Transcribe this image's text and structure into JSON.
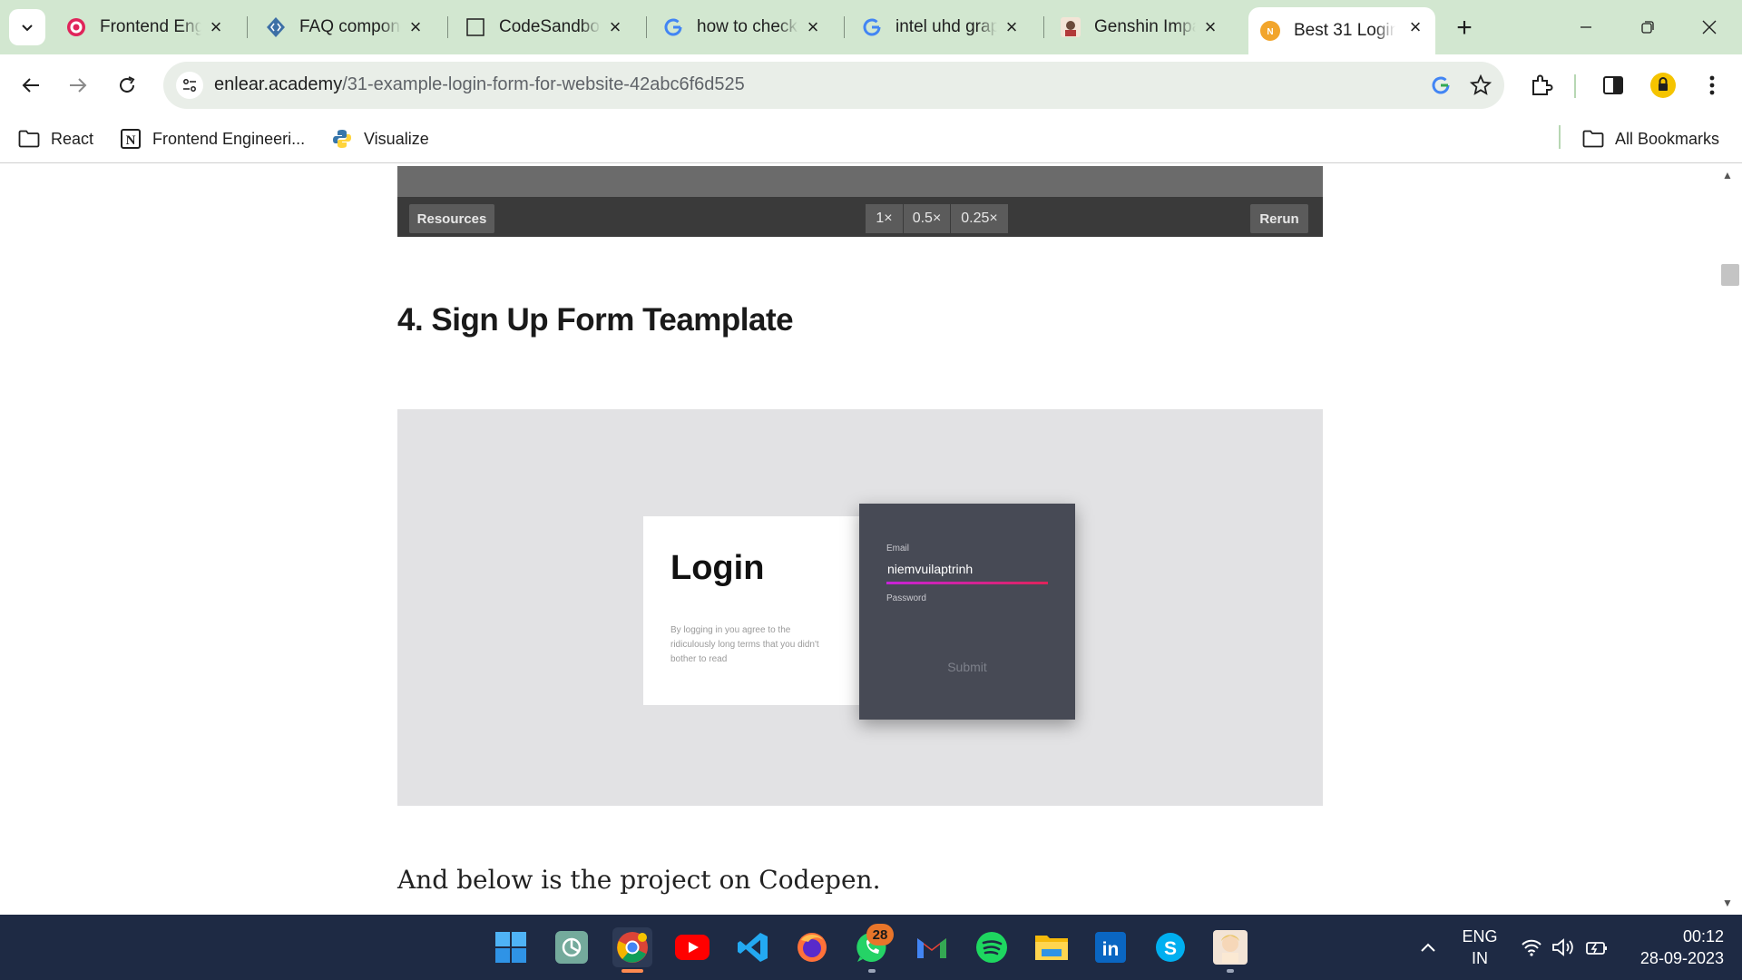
{
  "browser": {
    "tabs": [
      {
        "title": "Frontend Eng",
        "favicon": "target-icon"
      },
      {
        "title": "FAQ compone",
        "favicon": "code-icon"
      },
      {
        "title": "CodeSandbox",
        "favicon": "box-icon"
      },
      {
        "title": "how to check",
        "favicon": "google-icon"
      },
      {
        "title": "intel uhd grap",
        "favicon": "google-icon"
      },
      {
        "title": "Genshin Impa",
        "favicon": "anime-icon"
      },
      {
        "title": "Best 31 Login",
        "favicon": "enlear-icon",
        "active": true
      }
    ],
    "url_host": "enlear.academy",
    "url_path": "/31-example-login-form-for-website-42abc6f6d525"
  },
  "bookmarks": [
    {
      "label": "React",
      "icon": "folder-icon"
    },
    {
      "label": "Frontend Engineeri...",
      "icon": "notion-icon"
    },
    {
      "label": "Visualize",
      "icon": "python-icon"
    }
  ],
  "bookmarks_all": "All Bookmarks",
  "player": {
    "resources": "Resources",
    "speeds": [
      "1×",
      "0.5×",
      "0.25×"
    ],
    "rerun": "Rerun"
  },
  "section": {
    "heading": "4. Sign Up Form Teamplate"
  },
  "demo": {
    "login_title": "Login",
    "terms": "By logging in you agree to the ridiculously long terms that you didn't bother to read",
    "email_label": "Email",
    "email_value": "niemvuilaptrinh",
    "password_label": "Password",
    "submit_label": "Submit"
  },
  "body_text": "And below is the project on Codepen.",
  "taskbar": {
    "whatsapp_badge": "28",
    "lang_line1": "ENG",
    "lang_line2": "IN",
    "time": "00:12",
    "date": "28-09-2023"
  },
  "colors": {
    "tab_strip": "#d2e7d0",
    "taskbar": "#1e2a44",
    "form_card": "#474a55",
    "email_underline_start": "#c624d9",
    "email_underline_end": "#e0245a"
  }
}
